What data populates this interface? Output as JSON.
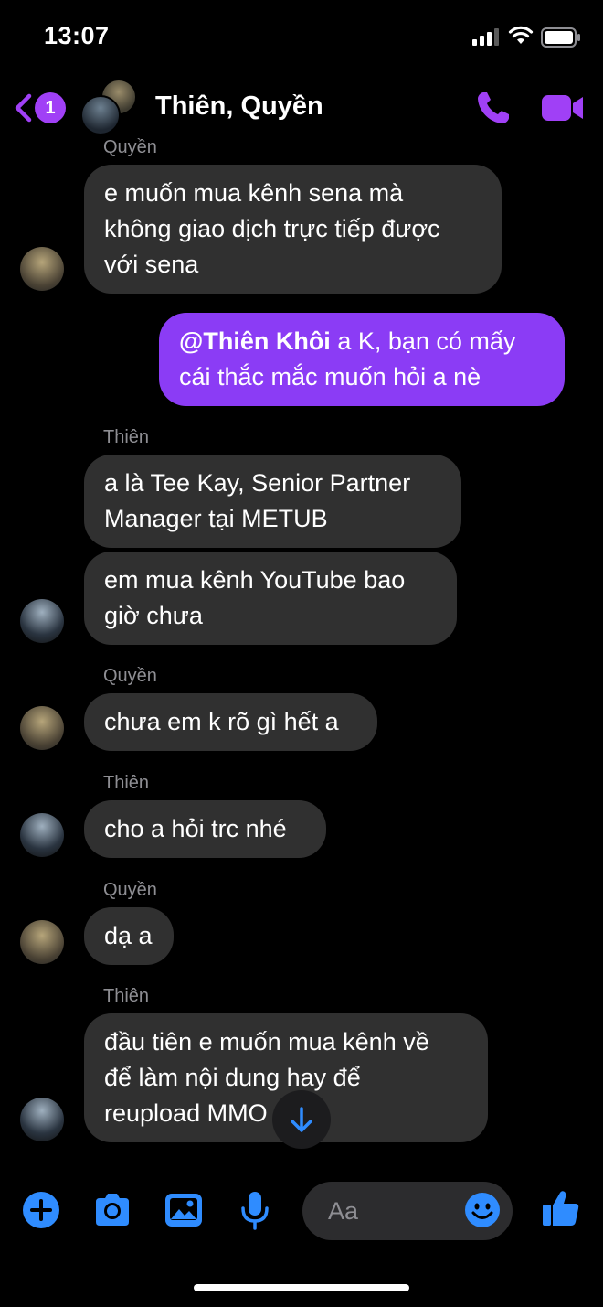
{
  "status_bar": {
    "time": "13:07"
  },
  "header": {
    "unread_count": "1",
    "title": "Thiên, Quyền"
  },
  "messages": [
    {
      "sender_label": "Quyền",
      "text": "e muốn mua kênh sena mà\nkhông giao dịch trực tiếp được\nvới sena"
    },
    {
      "mention": "@Thiên Khôi",
      "text": " a K, bạn có mấy\ncái thắc mắc muốn hỏi a nè"
    },
    {
      "sender_label": "Thiên",
      "text": "a là Tee Kay, Senior Partner\nManager tại METUB"
    },
    {
      "text": "em mua kênh YouTube bao\ngiờ chưa"
    },
    {
      "sender_label": "Quyền",
      "text": "chưa em k rõ gì hết a"
    },
    {
      "sender_label": "Thiên",
      "text": "cho a hỏi trc nhé"
    },
    {
      "sender_label": "Quyền",
      "text": "dạ a"
    },
    {
      "sender_label": "Thiên",
      "text": "đầu tiên e muốn mua kênh về\nđể làm nội dung hay để\nreupload MMO"
    }
  ],
  "composer": {
    "placeholder": "Aa"
  },
  "colors": {
    "accent": "#a040f6",
    "outgoing_bubble": "#8b3cf5",
    "incoming_bubble": "#303030",
    "composer_icons": "#2f8cff"
  }
}
